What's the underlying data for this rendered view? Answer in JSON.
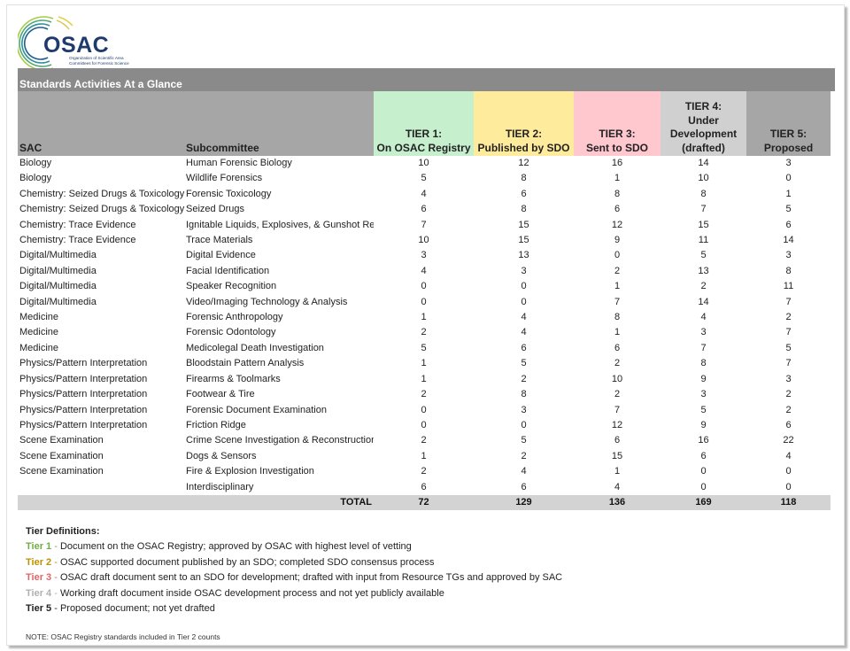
{
  "logo": {
    "name": "OSAC",
    "subtitle_line1": "Organization of Scientific Area",
    "subtitle_line2": "Committees for Forensic Science"
  },
  "title": "Standards Activities At a Glance",
  "columns": {
    "sac": "SAC",
    "subcommittee": "Subcommittee",
    "tier1": [
      "TIER 1:",
      "On OSAC Registry"
    ],
    "tier2": [
      "TIER 2:",
      "Published by SDO"
    ],
    "tier3": [
      "TIER 3:",
      "Sent to SDO"
    ],
    "tier4": [
      "TIER 4:",
      "Under",
      "Development",
      "(drafted)"
    ],
    "tier5": [
      "TIER 5:",
      "Proposed"
    ]
  },
  "colors": {
    "tier1_bg": "#c6efce",
    "tier1_text": "#196b24",
    "tier2_bg": "#ffeb9c",
    "tier2_text": "#9c6500",
    "tier3_bg": "#ffc7ce",
    "tier3_text": "#9c0006",
    "tier4_bg": "#d0d0d0",
    "tier5_bg": "#a6a6a6"
  },
  "rows": [
    {
      "sac": "Biology",
      "sub": "Human Forensic Biology",
      "t": [
        10,
        12,
        16,
        14,
        3
      ]
    },
    {
      "sac": "Biology",
      "sub": "Wildlife Forensics",
      "t": [
        5,
        8,
        1,
        10,
        0
      ]
    },
    {
      "sac": "Chemistry: Seized Drugs & Toxicology",
      "sub": "Forensic Toxicology",
      "t": [
        4,
        6,
        8,
        8,
        1
      ]
    },
    {
      "sac": "Chemistry: Seized Drugs & Toxicology",
      "sub": "Seized Drugs",
      "t": [
        6,
        8,
        6,
        7,
        5
      ]
    },
    {
      "sac": "Chemistry: Trace Evidence",
      "sub": "Ignitable Liquids, Explosives, & Gunshot Res",
      "t": [
        7,
        15,
        12,
        15,
        6
      ]
    },
    {
      "sac": "Chemistry: Trace Evidence",
      "sub": "Trace Materials",
      "t": [
        10,
        15,
        9,
        11,
        14
      ]
    },
    {
      "sac": "Digital/Multimedia",
      "sub": "Digital Evidence",
      "t": [
        3,
        13,
        0,
        5,
        3
      ]
    },
    {
      "sac": "Digital/Multimedia",
      "sub": "Facial Identification",
      "t": [
        4,
        3,
        2,
        13,
        8
      ]
    },
    {
      "sac": "Digital/Multimedia",
      "sub": "Speaker Recognition",
      "t": [
        0,
        0,
        1,
        2,
        11
      ]
    },
    {
      "sac": "Digital/Multimedia",
      "sub": "Video/Imaging Technology & Analysis",
      "t": [
        0,
        0,
        7,
        14,
        7
      ]
    },
    {
      "sac": "Medicine",
      "sub": "Forensic Anthropology",
      "t": [
        1,
        4,
        8,
        4,
        2
      ]
    },
    {
      "sac": "Medicine",
      "sub": "Forensic Odontology",
      "t": [
        2,
        4,
        1,
        3,
        7
      ]
    },
    {
      "sac": "Medicine",
      "sub": "Medicolegal Death Investigation",
      "t": [
        5,
        6,
        6,
        7,
        5
      ]
    },
    {
      "sac": "Physics/Pattern Interpretation",
      "sub": "Bloodstain Pattern Analysis",
      "t": [
        1,
        5,
        2,
        8,
        7
      ]
    },
    {
      "sac": "Physics/Pattern Interpretation",
      "sub": "Firearms & Toolmarks",
      "t": [
        1,
        2,
        10,
        9,
        3
      ]
    },
    {
      "sac": "Physics/Pattern Interpretation",
      "sub": "Footwear & Tire",
      "t": [
        2,
        8,
        2,
        3,
        2
      ]
    },
    {
      "sac": "Physics/Pattern Interpretation",
      "sub": "Forensic Document Examination",
      "t": [
        0,
        3,
        7,
        5,
        2
      ]
    },
    {
      "sac": "Physics/Pattern Interpretation",
      "sub": "Friction Ridge",
      "t": [
        0,
        0,
        12,
        9,
        6
      ]
    },
    {
      "sac": "Scene Examination",
      "sub": "Crime Scene Investigation & Reconstruction",
      "t": [
        2,
        5,
        6,
        16,
        22
      ]
    },
    {
      "sac": "Scene Examination",
      "sub": "Dogs & Sensors",
      "t": [
        1,
        2,
        15,
        6,
        4
      ]
    },
    {
      "sac": "Scene Examination",
      "sub": "Fire & Explosion Investigation",
      "t": [
        2,
        4,
        1,
        0,
        0
      ]
    },
    {
      "sac": "",
      "sub": "Interdisciplinary",
      "t": [
        6,
        6,
        4,
        0,
        0
      ]
    }
  ],
  "total": {
    "label": "TOTAL",
    "t": [
      72,
      129,
      136,
      169,
      118
    ]
  },
  "definitions": {
    "heading": "Tier Definitions:",
    "items": [
      {
        "key": "Tier 1",
        "sep": " - ",
        "text": "Document on the OSAC Registry; approved by OSAC with highest level of vetting"
      },
      {
        "key": "Tier 2",
        "sep": " - ",
        "text": "OSAC supported document published by an SDO; completed SDO consensus process"
      },
      {
        "key": "Tier 3",
        "sep": " - ",
        "text": "OSAC draft document sent to an SDO for development; drafted with input from Resource TGs and approved by SAC"
      },
      {
        "key": "Tier 4",
        "sep": " - ",
        "text": "Working draft document inside OSAC development process and not yet publicly available"
      },
      {
        "key": "Tier 5",
        "sep": " - ",
        "text": "Proposed document; not yet drafted"
      }
    ]
  },
  "note": "NOTE: OSAC Registry standards included in Tier 2 counts"
}
